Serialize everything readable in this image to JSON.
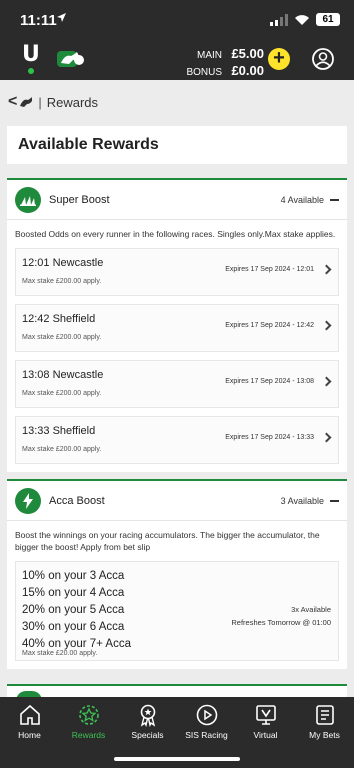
{
  "status_bar": {
    "time": "11:11",
    "battery": "61"
  },
  "header": {
    "main_label": "MAIN",
    "main_value": "£5.00",
    "bonus_label": "BONUS",
    "bonus_value": "£0.00",
    "deposit_symbol": "+"
  },
  "breadcrumb": {
    "back_symbol": "<",
    "separator": "|",
    "label": "Rewards"
  },
  "page_title": "Available Rewards",
  "super_boost": {
    "title": "Super Boost",
    "available": "4 Available",
    "description": "Boosted Odds on every runner in the following races. Singles only.Max stake applies.",
    "races": [
      {
        "race": "12:01 Newcastle",
        "stake": "Max stake £200.00 apply.",
        "expiry": "Expires 17 Sep 2024 - 12:01"
      },
      {
        "race": "12:42 Sheffield",
        "stake": "Max stake £200.00 apply.",
        "expiry": "Expires 17 Sep 2024 - 12:42"
      },
      {
        "race": "13:08 Newcastle",
        "stake": "Max stake £200.00 apply.",
        "expiry": "Expires 17 Sep 2024 - 13:08"
      },
      {
        "race": "13:33 Sheffield",
        "stake": "Max stake £200.00 apply.",
        "expiry": "Expires 17 Sep 2024 - 13:33"
      }
    ]
  },
  "acca_boost": {
    "title": "Acca Boost",
    "available": "3 Available",
    "description": "Boost the winnings on your racing accumulators. The bigger the accumulator, the bigger the boost! Apply from bet slip",
    "tiers": [
      "10% on your 3 Acca",
      "15% on your 4 Acca",
      "20% on your 5 Acca",
      "30% on your 6 Acca",
      "40% on your 7+ Acca"
    ],
    "stake": "Max stake £20.00 apply.",
    "avail_count": "3x Available",
    "refresh": "Refreshes Tomorrow @ 01:00"
  },
  "nav": [
    {
      "label": "Home",
      "icon": "home-icon"
    },
    {
      "label": "Rewards",
      "icon": "rewards-icon"
    },
    {
      "label": "Specials",
      "icon": "specials-icon"
    },
    {
      "label": "SIS Racing",
      "icon": "play-icon"
    },
    {
      "label": "Virtual",
      "icon": "virtual-icon"
    },
    {
      "label": "My Bets",
      "icon": "bets-icon"
    }
  ],
  "colors": {
    "brand_green": "#1f8a3c",
    "active_nav": "#3cc254",
    "dark_bg": "#2b2b2b",
    "deposit_yellow": "#ffe32a"
  }
}
